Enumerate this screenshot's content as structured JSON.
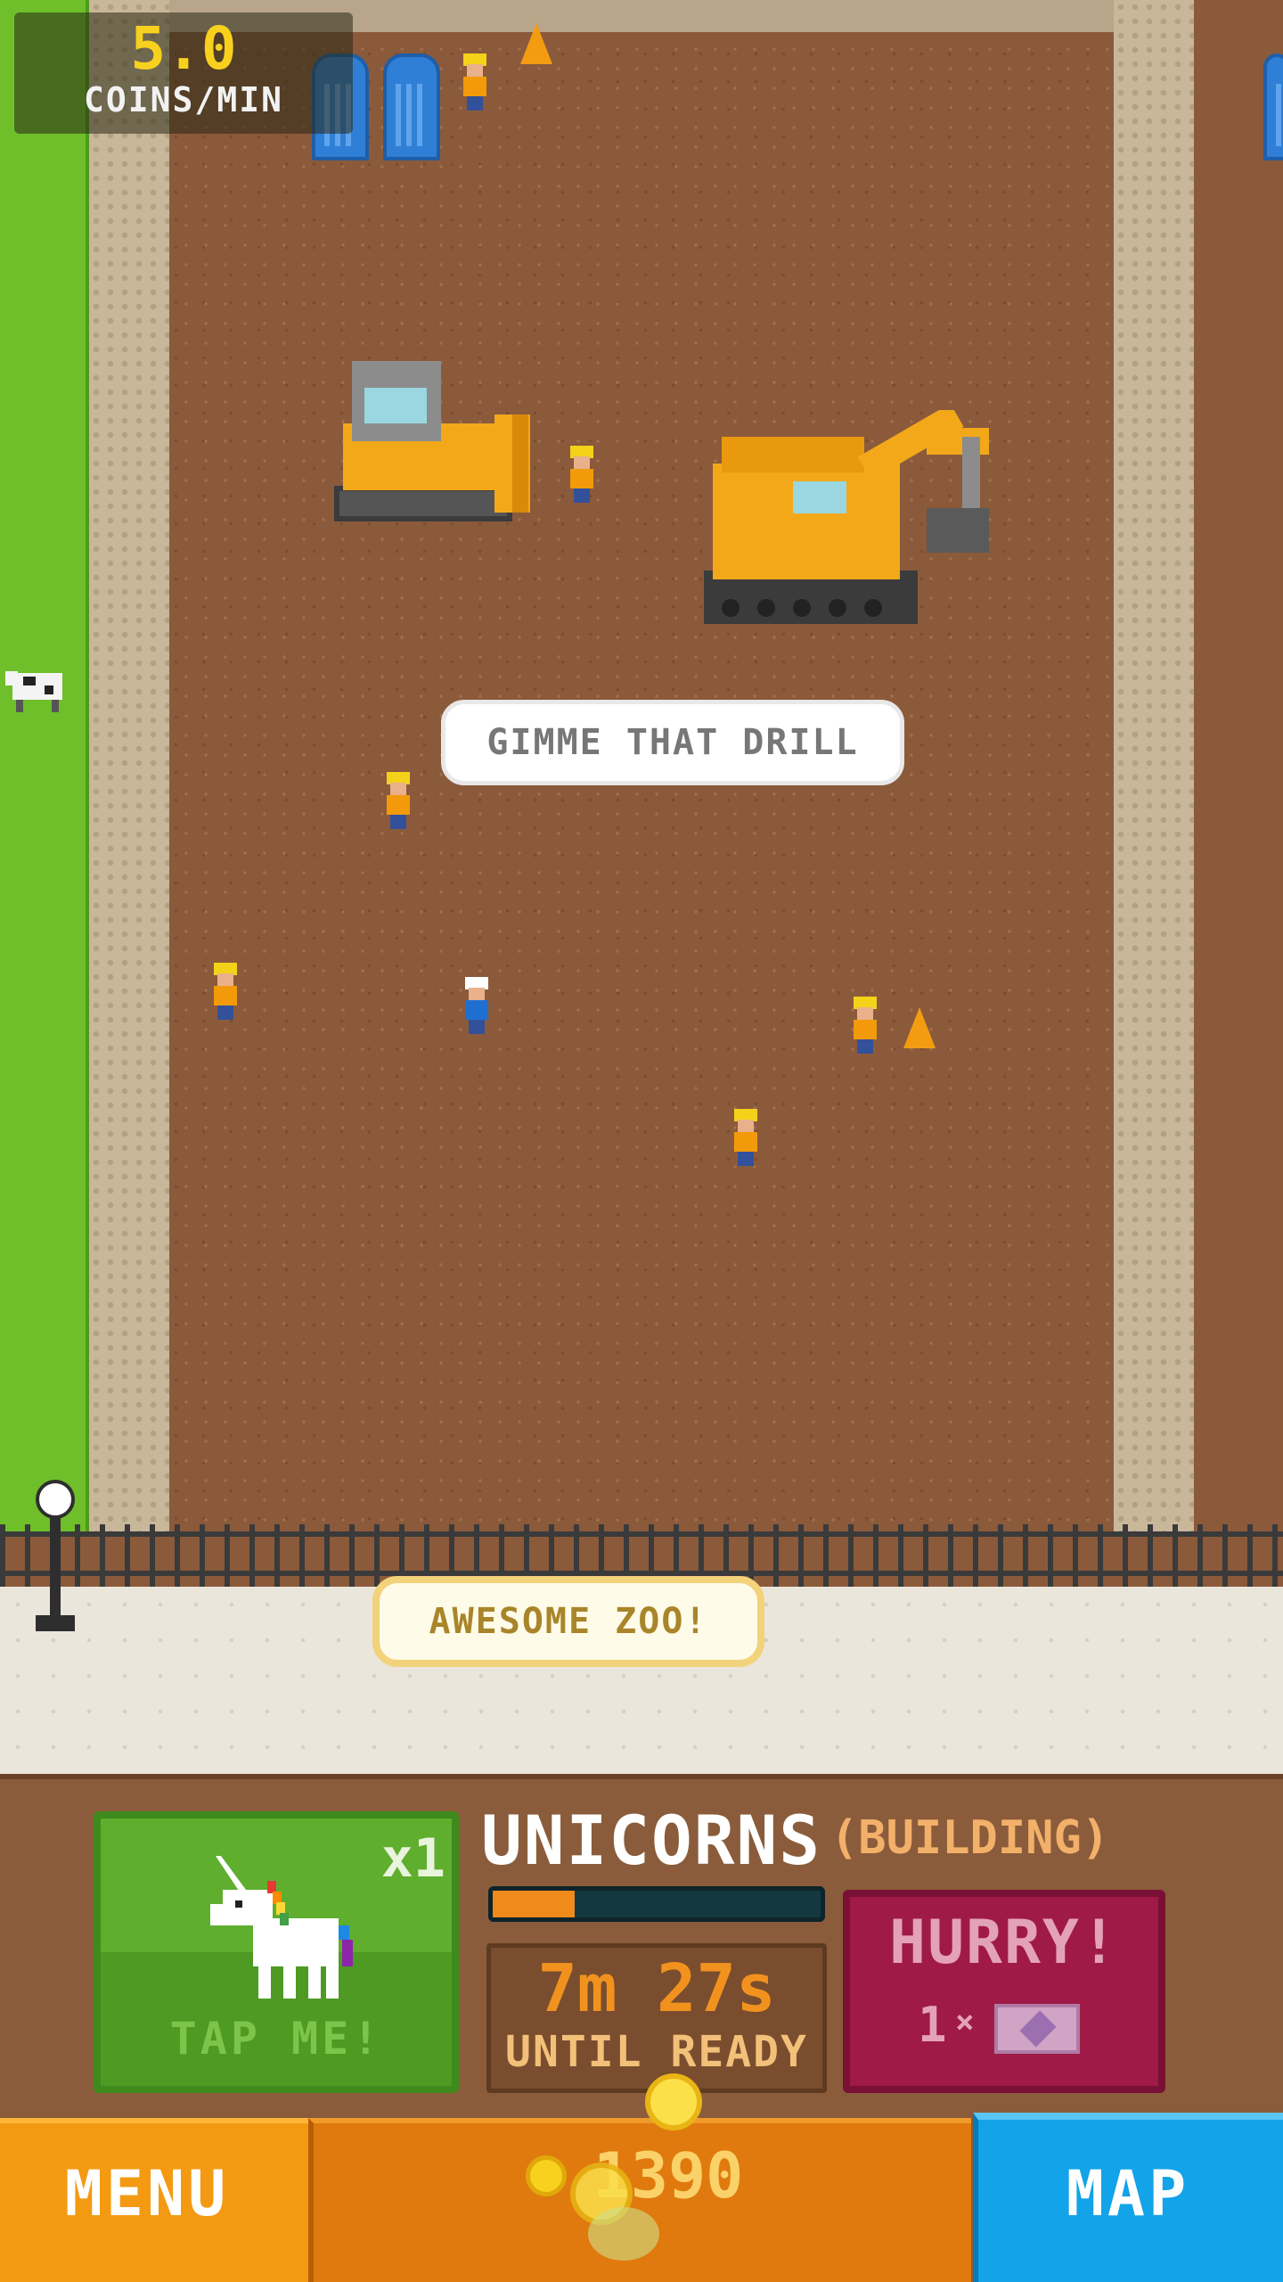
{
  "hud": {
    "rate_value": "5.0",
    "rate_unit": "COINS/MIN"
  },
  "scene": {
    "speech_worker": "GIMME THAT DRILL",
    "speech_visitor": "AWESOME ZOO!"
  },
  "exhibit": {
    "title": "UNICORNS",
    "status": "(BUILDING)",
    "animal_count": "x1",
    "tap_label": "TAP ME!",
    "progress": 0.25,
    "timer": "7m 27s",
    "timer_caption": "UNTIL READY",
    "hurry_label": "HURRY!",
    "hurry_cost": "1",
    "hurry_multiplier": "×"
  },
  "nav": {
    "menu_label": "MENU",
    "coins": "1390",
    "map_label": "MAP"
  },
  "colors": {
    "tap_card": "#5fae2e",
    "hurry": "#a01a47",
    "menu": "#f39a12",
    "map": "#12a3e8",
    "progress_fill": "#f08a1a"
  }
}
